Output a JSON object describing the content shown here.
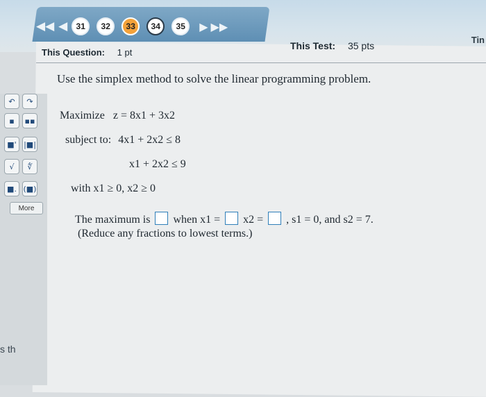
{
  "nav": {
    "prev_all": "◀◀",
    "prev": "◀",
    "pages": [
      "31",
      "32",
      "33",
      "34",
      "35"
    ],
    "current_page": "33",
    "next": "▶",
    "next_all": "▶▶"
  },
  "header": {
    "question_label": "This Question:",
    "question_pts": "1 pt",
    "test_label": "This Test:",
    "test_pts": "35 pts",
    "timer_label": "Tin"
  },
  "problem": {
    "instruction": "Use the simplex method to solve the linear programming problem.",
    "objective_prefix": "Maximize",
    "objective": "z = 8x1 + 3x2",
    "subject_to": "subject to:",
    "constraint1": "4x1 + 2x2 ≤ 8",
    "constraint2": "x1 + 2x2 ≤ 9",
    "nonneg": "with x1 ≥ 0, x2 ≥ 0"
  },
  "answer": {
    "prefix": "The maximum is",
    "when": "when x1 =",
    "x2": "x2 =",
    "tail": ", s1 = 0, and s2 = 7.",
    "note": "(Reduce any fractions to lowest terms.)"
  },
  "toolbar": {
    "more": "More"
  },
  "misc": {
    "left_bottom": "s th"
  }
}
